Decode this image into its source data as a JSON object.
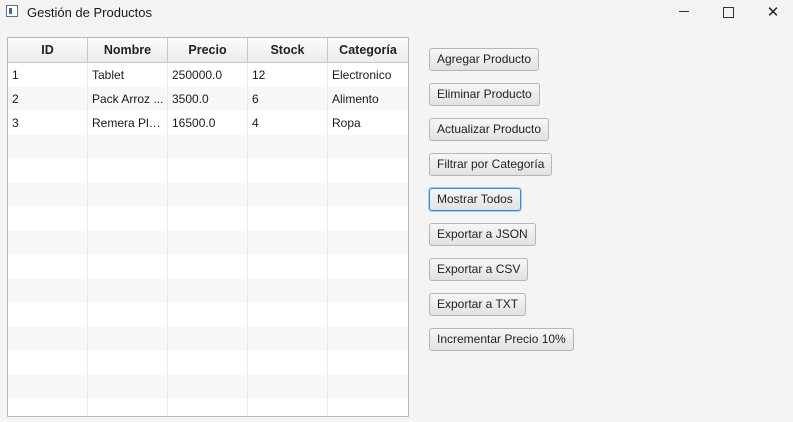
{
  "window": {
    "title": "Gestión de Productos",
    "minimize_glyph": "",
    "maximize_glyph": "",
    "close_glyph": "✕"
  },
  "table": {
    "columns": [
      "ID",
      "Nombre",
      "Precio",
      "Stock",
      "Categoría"
    ],
    "rows": [
      [
        "1",
        "Tablet",
        "250000.0",
        "12",
        "Electronico"
      ],
      [
        "2",
        " Pack Arroz ...",
        "3500.0",
        "6",
        "Alimento"
      ],
      [
        "3",
        "Remera Playa",
        "16500.0",
        "4",
        "Ropa"
      ]
    ],
    "empty_row_count": 12
  },
  "buttons": [
    {
      "id": "agregar",
      "label": "Agregar Producto"
    },
    {
      "id": "eliminar",
      "label": "Eliminar Producto"
    },
    {
      "id": "actualizar",
      "label": "Actualizar Producto"
    },
    {
      "id": "filtrar",
      "label": "Filtrar por Categoría"
    },
    {
      "id": "mostrar",
      "label": "Mostrar Todos",
      "focused": true
    },
    {
      "id": "json",
      "label": "Exportar a JSON"
    },
    {
      "id": "csv",
      "label": "Exportar a CSV"
    },
    {
      "id": "txt",
      "label": "Exportar a TXT"
    },
    {
      "id": "incrementar",
      "label": "Incrementar Precio 10%"
    }
  ]
}
